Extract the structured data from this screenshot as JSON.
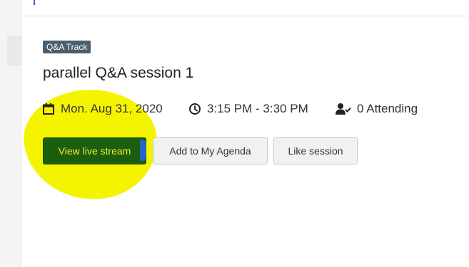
{
  "session": {
    "track_badge": "Q&A Track",
    "title": "parallel Q&A session 1",
    "date": "Mon. Aug 31, 2020",
    "time": "3:15 PM - 3:30 PM",
    "attendance": "0 Attending"
  },
  "actions": {
    "view_live_stream": "View live stream",
    "add_to_agenda": "Add to My Agenda",
    "like_session": "Like session"
  },
  "icons": {
    "date": "calendar-icon",
    "time": "clock-icon",
    "attendance": "user-check-icon"
  },
  "colors": {
    "live_button_bg": "#1b5e0e",
    "live_button_text": "#f1ea33",
    "highlight": "#f4f400",
    "badge_bg": "#4a5e6d"
  }
}
